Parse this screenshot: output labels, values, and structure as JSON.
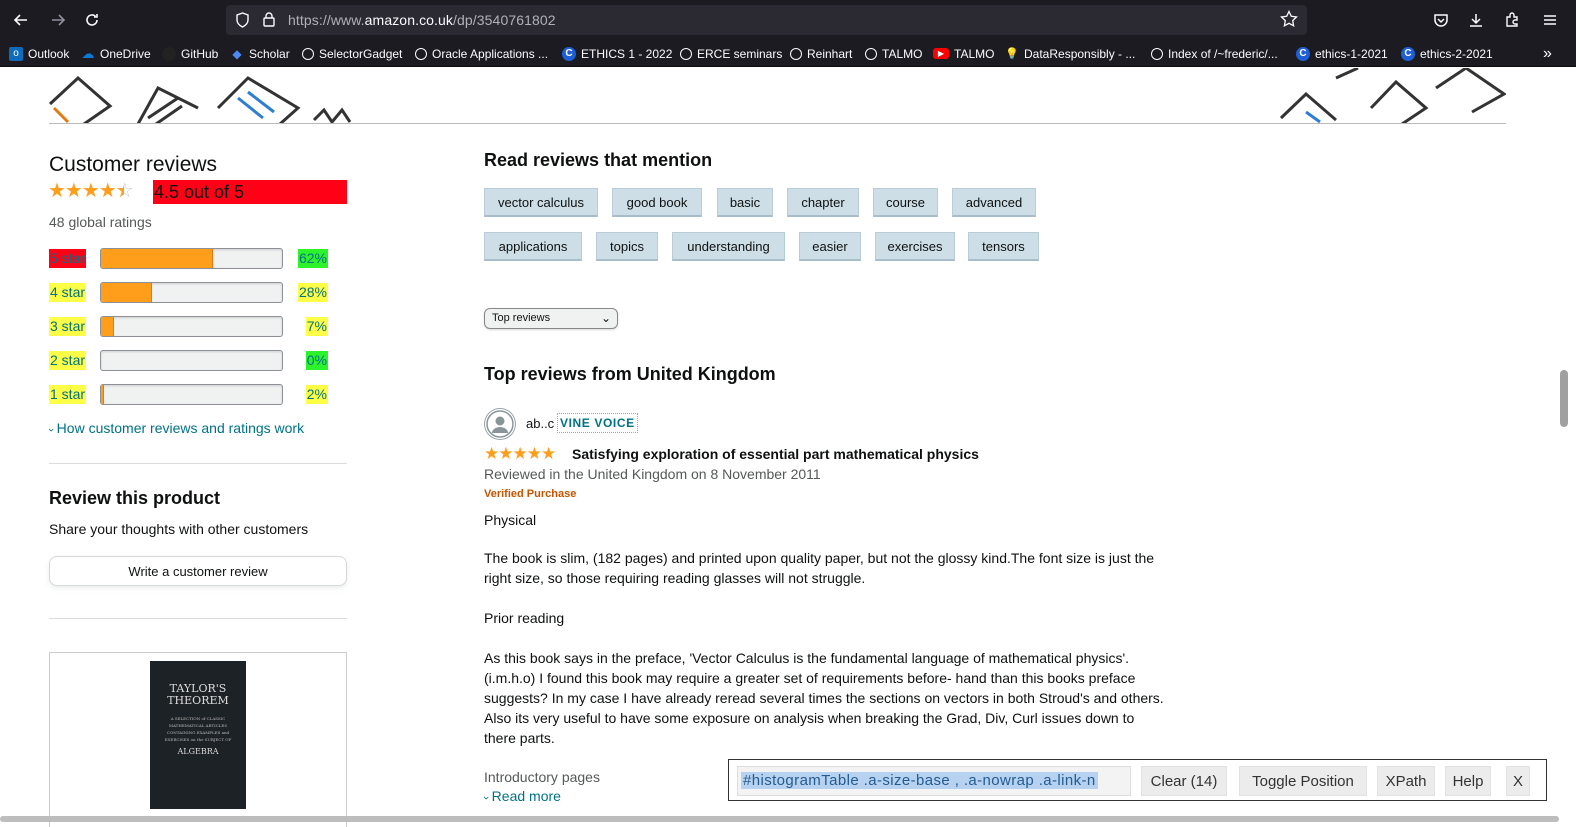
{
  "browser": {
    "url_prefix": "https://www.",
    "url_domain": "amazon.co.uk",
    "url_path": "/dp/3540761802",
    "bookmarks": [
      {
        "label": "Outlook",
        "icon": "outlook-icon",
        "color": "#0f6cbd"
      },
      {
        "label": "OneDrive",
        "icon": "onedrive-icon",
        "color": "#0a7bd8"
      },
      {
        "label": "GitHub",
        "icon": "github-icon",
        "color": "#222222"
      },
      {
        "label": "Scholar",
        "icon": "scholar-icon",
        "color": "#4a8af4"
      },
      {
        "label": "SelectorGadget",
        "icon": "globe-icon",
        "color": ""
      },
      {
        "label": "Oracle Applications ...",
        "icon": "globe-icon",
        "color": ""
      },
      {
        "label": "ETHICS 1 - 2022",
        "icon": "c-icon",
        "color": "#1e5fd6"
      },
      {
        "label": "ERCE seminars",
        "icon": "globe-icon",
        "color": ""
      },
      {
        "label": "Reinhart",
        "icon": "globe-icon",
        "color": ""
      },
      {
        "label": "TALMO",
        "icon": "globe-icon",
        "color": ""
      },
      {
        "label": "TALMO",
        "icon": "youtube-icon",
        "color": "#ff0000"
      },
      {
        "label": "DataResponsibly - ...",
        "icon": "bulb-icon",
        "color": ""
      },
      {
        "label": "Index of /~frederic/...",
        "icon": "globe-icon",
        "color": ""
      },
      {
        "label": "ethics-1-2021",
        "icon": "c-icon",
        "color": "#1e5fd6"
      },
      {
        "label": "ethics-2-2021",
        "icon": "c-icon",
        "color": "#1e5fd6"
      }
    ]
  },
  "reviews_summary": {
    "title": "Customer reviews",
    "rating_text": "4.5 out of 5",
    "global_ratings": "48 global ratings",
    "histogram": [
      {
        "label": "5 star",
        "percent": 62,
        "pct_text": "62%",
        "label_bg": "#ff0016",
        "pct_bg": "#2df32d"
      },
      {
        "label": "4 star",
        "percent": 28,
        "pct_text": "28%",
        "label_bg": "#fdff47",
        "pct_bg": "#fdff47"
      },
      {
        "label": "3 star",
        "percent": 7,
        "pct_text": "7%",
        "label_bg": "#fdff47",
        "pct_bg": "#fdff47"
      },
      {
        "label": "2 star",
        "percent": 0,
        "pct_text": "0%",
        "label_bg": "#fdff47",
        "pct_bg": "#2df32d"
      },
      {
        "label": "1 star",
        "percent": 2,
        "pct_text": "2%",
        "label_bg": "#fdff47",
        "pct_bg": "#fdff47"
      }
    ],
    "how_link": "How customer reviews and ratings work"
  },
  "review_product": {
    "title": "Review this product",
    "subtitle": "Share your thoughts with other customers",
    "button": "Write a customer review"
  },
  "book_card": {
    "cover_title_1": "TAYLOR'S",
    "cover_title_2": "THEOREM",
    "cover_small": "A SELECTION of CLASSIC MATHEMATICAL ARTICLES CONTAINING EXAMPLES and EXERCISES on the SUBJECT OF",
    "cover_bottom": "ALGEBRA"
  },
  "mentions": {
    "title": "Read reviews that mention",
    "tags_row1": [
      "vector calculus",
      "good book",
      "basic",
      "chapter",
      "course",
      "advanced"
    ],
    "tags_row2": [
      "applications",
      "topics",
      "understanding",
      "easier",
      "exercises",
      "tensors"
    ]
  },
  "sort": {
    "selected": "Top reviews"
  },
  "top_reviews": {
    "title": "Top reviews from United Kingdom",
    "review": {
      "author": "ab..c",
      "badge": "VINE VOICE",
      "headline": "Satisfying exploration of essential part mathematical physics",
      "meta": "Reviewed in the United Kingdom on 8 November 2011",
      "verified": "Verified Purchase",
      "p1": "Physical",
      "p2": "The book is slim, (182 pages) and printed upon quality paper, but not the glossy kind.The font size is just the right size, so those requiring reading glasses will not struggle.",
      "p3": "Prior reading",
      "p4": "As this book says in the preface, 'Vector Calculus is the fundamental language of mathematical physics'. (i.m.h.o) I found this book may require a greater set of requirements before- hand than this books preface suggests? In my case I have already reread several times the sections on vectors in both Stroud's and others. Also its very useful to have some exposure on analysis when breaking the Grad, Div, Curl issues down to there parts.",
      "p5": "Introductory pages",
      "read_more": "Read more"
    }
  },
  "selector_gadget": {
    "selector": "#histogramTable .a-size-base , .a-nowrap .a-link-n",
    "clear": "Clear (14)",
    "toggle": "Toggle Position",
    "xpath": "XPath",
    "help": "Help",
    "close": "X"
  }
}
